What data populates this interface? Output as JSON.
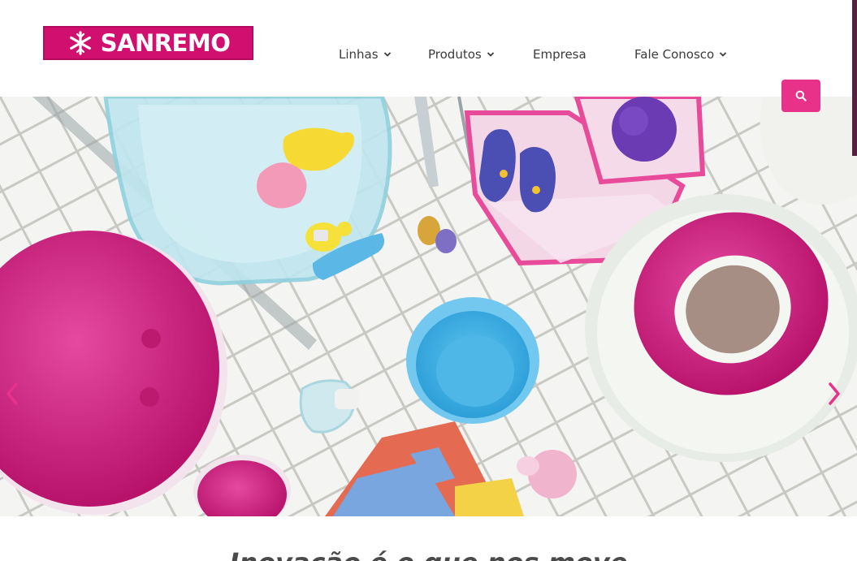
{
  "brand": {
    "name": "SANREMO",
    "color": "#d10f6f"
  },
  "nav": {
    "items": [
      {
        "label": "Linhas",
        "has_dropdown": true
      },
      {
        "label": "Produtos",
        "has_dropdown": true
      },
      {
        "label": "Empresa",
        "has_dropdown": false
      },
      {
        "label": "Fale Conosco",
        "has_dropdown": true
      }
    ],
    "search_icon": "search-icon"
  },
  "hero": {
    "image_subject": "hero-photo-baby-bath-products",
    "prev_icon": "chevron-left-icon",
    "next_icon": "chevron-right-icon",
    "accent_color": "#e8328a"
  },
  "section": {
    "tagline": "Inovação é o que nos move"
  }
}
